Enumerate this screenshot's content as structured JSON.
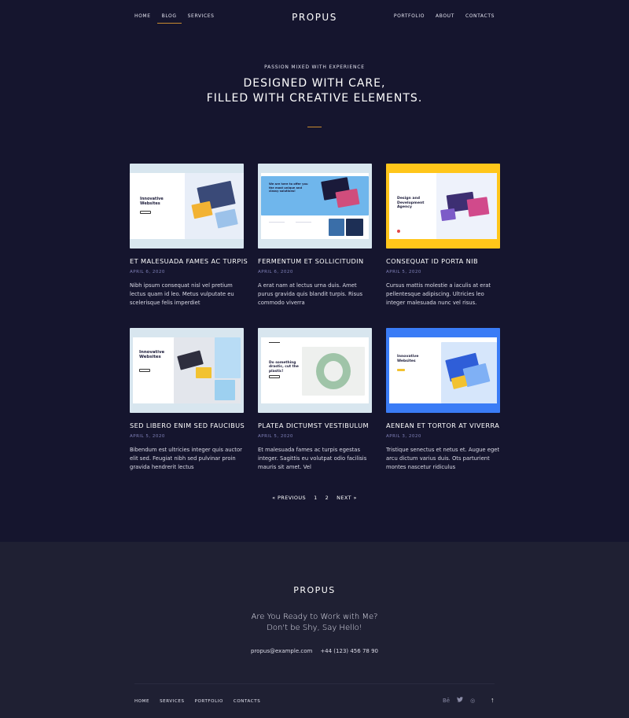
{
  "header": {
    "logo": "PROPUS",
    "nav_left": [
      "HOME",
      "BLOG",
      "SERVICES"
    ],
    "nav_right": [
      "PORTFOLIO",
      "ABOUT",
      "CONTACTS"
    ],
    "active": "BLOG"
  },
  "hero": {
    "kicker": "PASSION MIXED WITH EXPERIENCE",
    "headline_line1": "DESIGNED WITH CARE,",
    "headline_line2": "FILLED WITH CREATIVE ELEMENTS."
  },
  "posts": [
    {
      "title": "ET MALESUADA FAMES AC TURPIS",
      "date": "APRIL 6, 2020",
      "excerpt": "Nibh ipsum consequat nisl vel pretium lectus quam id leo. Metus vulputate eu scelerisque felis imperdiet",
      "thumb_bg": "#d8e6ef",
      "thumb_heading": "Innovative Websites"
    },
    {
      "title": "FERMENTUM ET SOLLICITUDIN",
      "date": "APRIL 6, 2020",
      "excerpt": "A erat nam at lectus urna duis. Amet purus gravida quis blandit turpis. Risus commodo viverra",
      "thumb_bg": "#d8e6ef",
      "thumb_heading": "We are here to offer you the most unique and classy solutions!"
    },
    {
      "title": "CONSEQUAT ID PORTA NIB",
      "date": "APRIL 5, 2020",
      "excerpt": "Cursus mattis molestie a iaculis at erat pellentesque adipiscing. Ultricies leo integer malesuada nunc vel risus.",
      "thumb_bg": "#ffc61a",
      "thumb_heading": "Design and Development Agency"
    },
    {
      "title": "SED LIBERO ENIM SED FAUCIBUS",
      "date": "APRIL 5, 2020",
      "excerpt": "Bibendum est ultricies integer quis auctor elit sed. Feugiat nibh sed pulvinar proin gravida hendrerit lectus",
      "thumb_bg": "#d8e6ef",
      "thumb_heading": "Innovative Websites"
    },
    {
      "title": "PLATEA DICTUMST VESTIBULUM",
      "date": "APRIL 5, 2020",
      "excerpt": "Et malesuada fames ac turpis egestas integer. Sagittis eu volutpat odio facilisis mauris sit amet. Vel",
      "thumb_bg": "#d8e6ef",
      "thumb_heading": "Do something drastic, cut the plastic!"
    },
    {
      "title": "AENEAN ET TORTOR AT VIVERRA",
      "date": "APRIL 3, 2020",
      "excerpt": "Tristique senectus et netus et. Augue eget arcu dictum varius duis. Ots parturient montes nascetur ridiculus",
      "thumb_bg": "#3a7cf6",
      "thumb_heading": "Innovative Websites"
    }
  ],
  "pagination": {
    "prev": "« PREVIOUS",
    "pages": [
      "1",
      "2"
    ],
    "next": "NEXT »"
  },
  "footer": {
    "logo": "PROPUS",
    "tagline_line1": "Are You Ready to Work with Me?",
    "tagline_line2": "Don't be Shy, Say Hello!",
    "email": "propus@example.com",
    "phone": "+44 (123) 456 78 90",
    "nav": [
      "HOME",
      "SERVICES",
      "PORTFOLIO",
      "CONTACTS"
    ],
    "social": [
      "behance-icon",
      "twitter-icon",
      "dribbble-icon"
    ],
    "social_glyphs": [
      "Bē",
      "🐦",
      "◎"
    ],
    "back_to_top": "↑"
  },
  "colors": {
    "background": "#15152e",
    "footer": "#1f2033",
    "accent": "#c98b2f",
    "date": "#7f80b8"
  }
}
